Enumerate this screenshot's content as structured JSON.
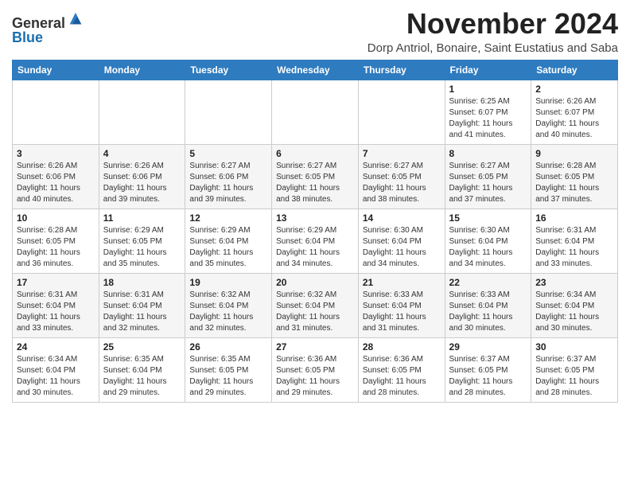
{
  "logo": {
    "general": "General",
    "blue": "Blue"
  },
  "header": {
    "month": "November 2024",
    "location": "Dorp Antriol, Bonaire, Saint Eustatius and Saba"
  },
  "days_of_week": [
    "Sunday",
    "Monday",
    "Tuesday",
    "Wednesday",
    "Thursday",
    "Friday",
    "Saturday"
  ],
  "weeks": [
    [
      {
        "day": "",
        "info": ""
      },
      {
        "day": "",
        "info": ""
      },
      {
        "day": "",
        "info": ""
      },
      {
        "day": "",
        "info": ""
      },
      {
        "day": "",
        "info": ""
      },
      {
        "day": "1",
        "info": "Sunrise: 6:25 AM\nSunset: 6:07 PM\nDaylight: 11 hours\nand 41 minutes."
      },
      {
        "day": "2",
        "info": "Sunrise: 6:26 AM\nSunset: 6:07 PM\nDaylight: 11 hours\nand 40 minutes."
      }
    ],
    [
      {
        "day": "3",
        "info": "Sunrise: 6:26 AM\nSunset: 6:06 PM\nDaylight: 11 hours\nand 40 minutes."
      },
      {
        "day": "4",
        "info": "Sunrise: 6:26 AM\nSunset: 6:06 PM\nDaylight: 11 hours\nand 39 minutes."
      },
      {
        "day": "5",
        "info": "Sunrise: 6:27 AM\nSunset: 6:06 PM\nDaylight: 11 hours\nand 39 minutes."
      },
      {
        "day": "6",
        "info": "Sunrise: 6:27 AM\nSunset: 6:05 PM\nDaylight: 11 hours\nand 38 minutes."
      },
      {
        "day": "7",
        "info": "Sunrise: 6:27 AM\nSunset: 6:05 PM\nDaylight: 11 hours\nand 38 minutes."
      },
      {
        "day": "8",
        "info": "Sunrise: 6:27 AM\nSunset: 6:05 PM\nDaylight: 11 hours\nand 37 minutes."
      },
      {
        "day": "9",
        "info": "Sunrise: 6:28 AM\nSunset: 6:05 PM\nDaylight: 11 hours\nand 37 minutes."
      }
    ],
    [
      {
        "day": "10",
        "info": "Sunrise: 6:28 AM\nSunset: 6:05 PM\nDaylight: 11 hours\nand 36 minutes."
      },
      {
        "day": "11",
        "info": "Sunrise: 6:29 AM\nSunset: 6:05 PM\nDaylight: 11 hours\nand 35 minutes."
      },
      {
        "day": "12",
        "info": "Sunrise: 6:29 AM\nSunset: 6:04 PM\nDaylight: 11 hours\nand 35 minutes."
      },
      {
        "day": "13",
        "info": "Sunrise: 6:29 AM\nSunset: 6:04 PM\nDaylight: 11 hours\nand 34 minutes."
      },
      {
        "day": "14",
        "info": "Sunrise: 6:30 AM\nSunset: 6:04 PM\nDaylight: 11 hours\nand 34 minutes."
      },
      {
        "day": "15",
        "info": "Sunrise: 6:30 AM\nSunset: 6:04 PM\nDaylight: 11 hours\nand 34 minutes."
      },
      {
        "day": "16",
        "info": "Sunrise: 6:31 AM\nSunset: 6:04 PM\nDaylight: 11 hours\nand 33 minutes."
      }
    ],
    [
      {
        "day": "17",
        "info": "Sunrise: 6:31 AM\nSunset: 6:04 PM\nDaylight: 11 hours\nand 33 minutes."
      },
      {
        "day": "18",
        "info": "Sunrise: 6:31 AM\nSunset: 6:04 PM\nDaylight: 11 hours\nand 32 minutes."
      },
      {
        "day": "19",
        "info": "Sunrise: 6:32 AM\nSunset: 6:04 PM\nDaylight: 11 hours\nand 32 minutes."
      },
      {
        "day": "20",
        "info": "Sunrise: 6:32 AM\nSunset: 6:04 PM\nDaylight: 11 hours\nand 31 minutes."
      },
      {
        "day": "21",
        "info": "Sunrise: 6:33 AM\nSunset: 6:04 PM\nDaylight: 11 hours\nand 31 minutes."
      },
      {
        "day": "22",
        "info": "Sunrise: 6:33 AM\nSunset: 6:04 PM\nDaylight: 11 hours\nand 30 minutes."
      },
      {
        "day": "23",
        "info": "Sunrise: 6:34 AM\nSunset: 6:04 PM\nDaylight: 11 hours\nand 30 minutes."
      }
    ],
    [
      {
        "day": "24",
        "info": "Sunrise: 6:34 AM\nSunset: 6:04 PM\nDaylight: 11 hours\nand 30 minutes."
      },
      {
        "day": "25",
        "info": "Sunrise: 6:35 AM\nSunset: 6:04 PM\nDaylight: 11 hours\nand 29 minutes."
      },
      {
        "day": "26",
        "info": "Sunrise: 6:35 AM\nSunset: 6:05 PM\nDaylight: 11 hours\nand 29 minutes."
      },
      {
        "day": "27",
        "info": "Sunrise: 6:36 AM\nSunset: 6:05 PM\nDaylight: 11 hours\nand 29 minutes."
      },
      {
        "day": "28",
        "info": "Sunrise: 6:36 AM\nSunset: 6:05 PM\nDaylight: 11 hours\nand 28 minutes."
      },
      {
        "day": "29",
        "info": "Sunrise: 6:37 AM\nSunset: 6:05 PM\nDaylight: 11 hours\nand 28 minutes."
      },
      {
        "day": "30",
        "info": "Sunrise: 6:37 AM\nSunset: 6:05 PM\nDaylight: 11 hours\nand 28 minutes."
      }
    ]
  ]
}
